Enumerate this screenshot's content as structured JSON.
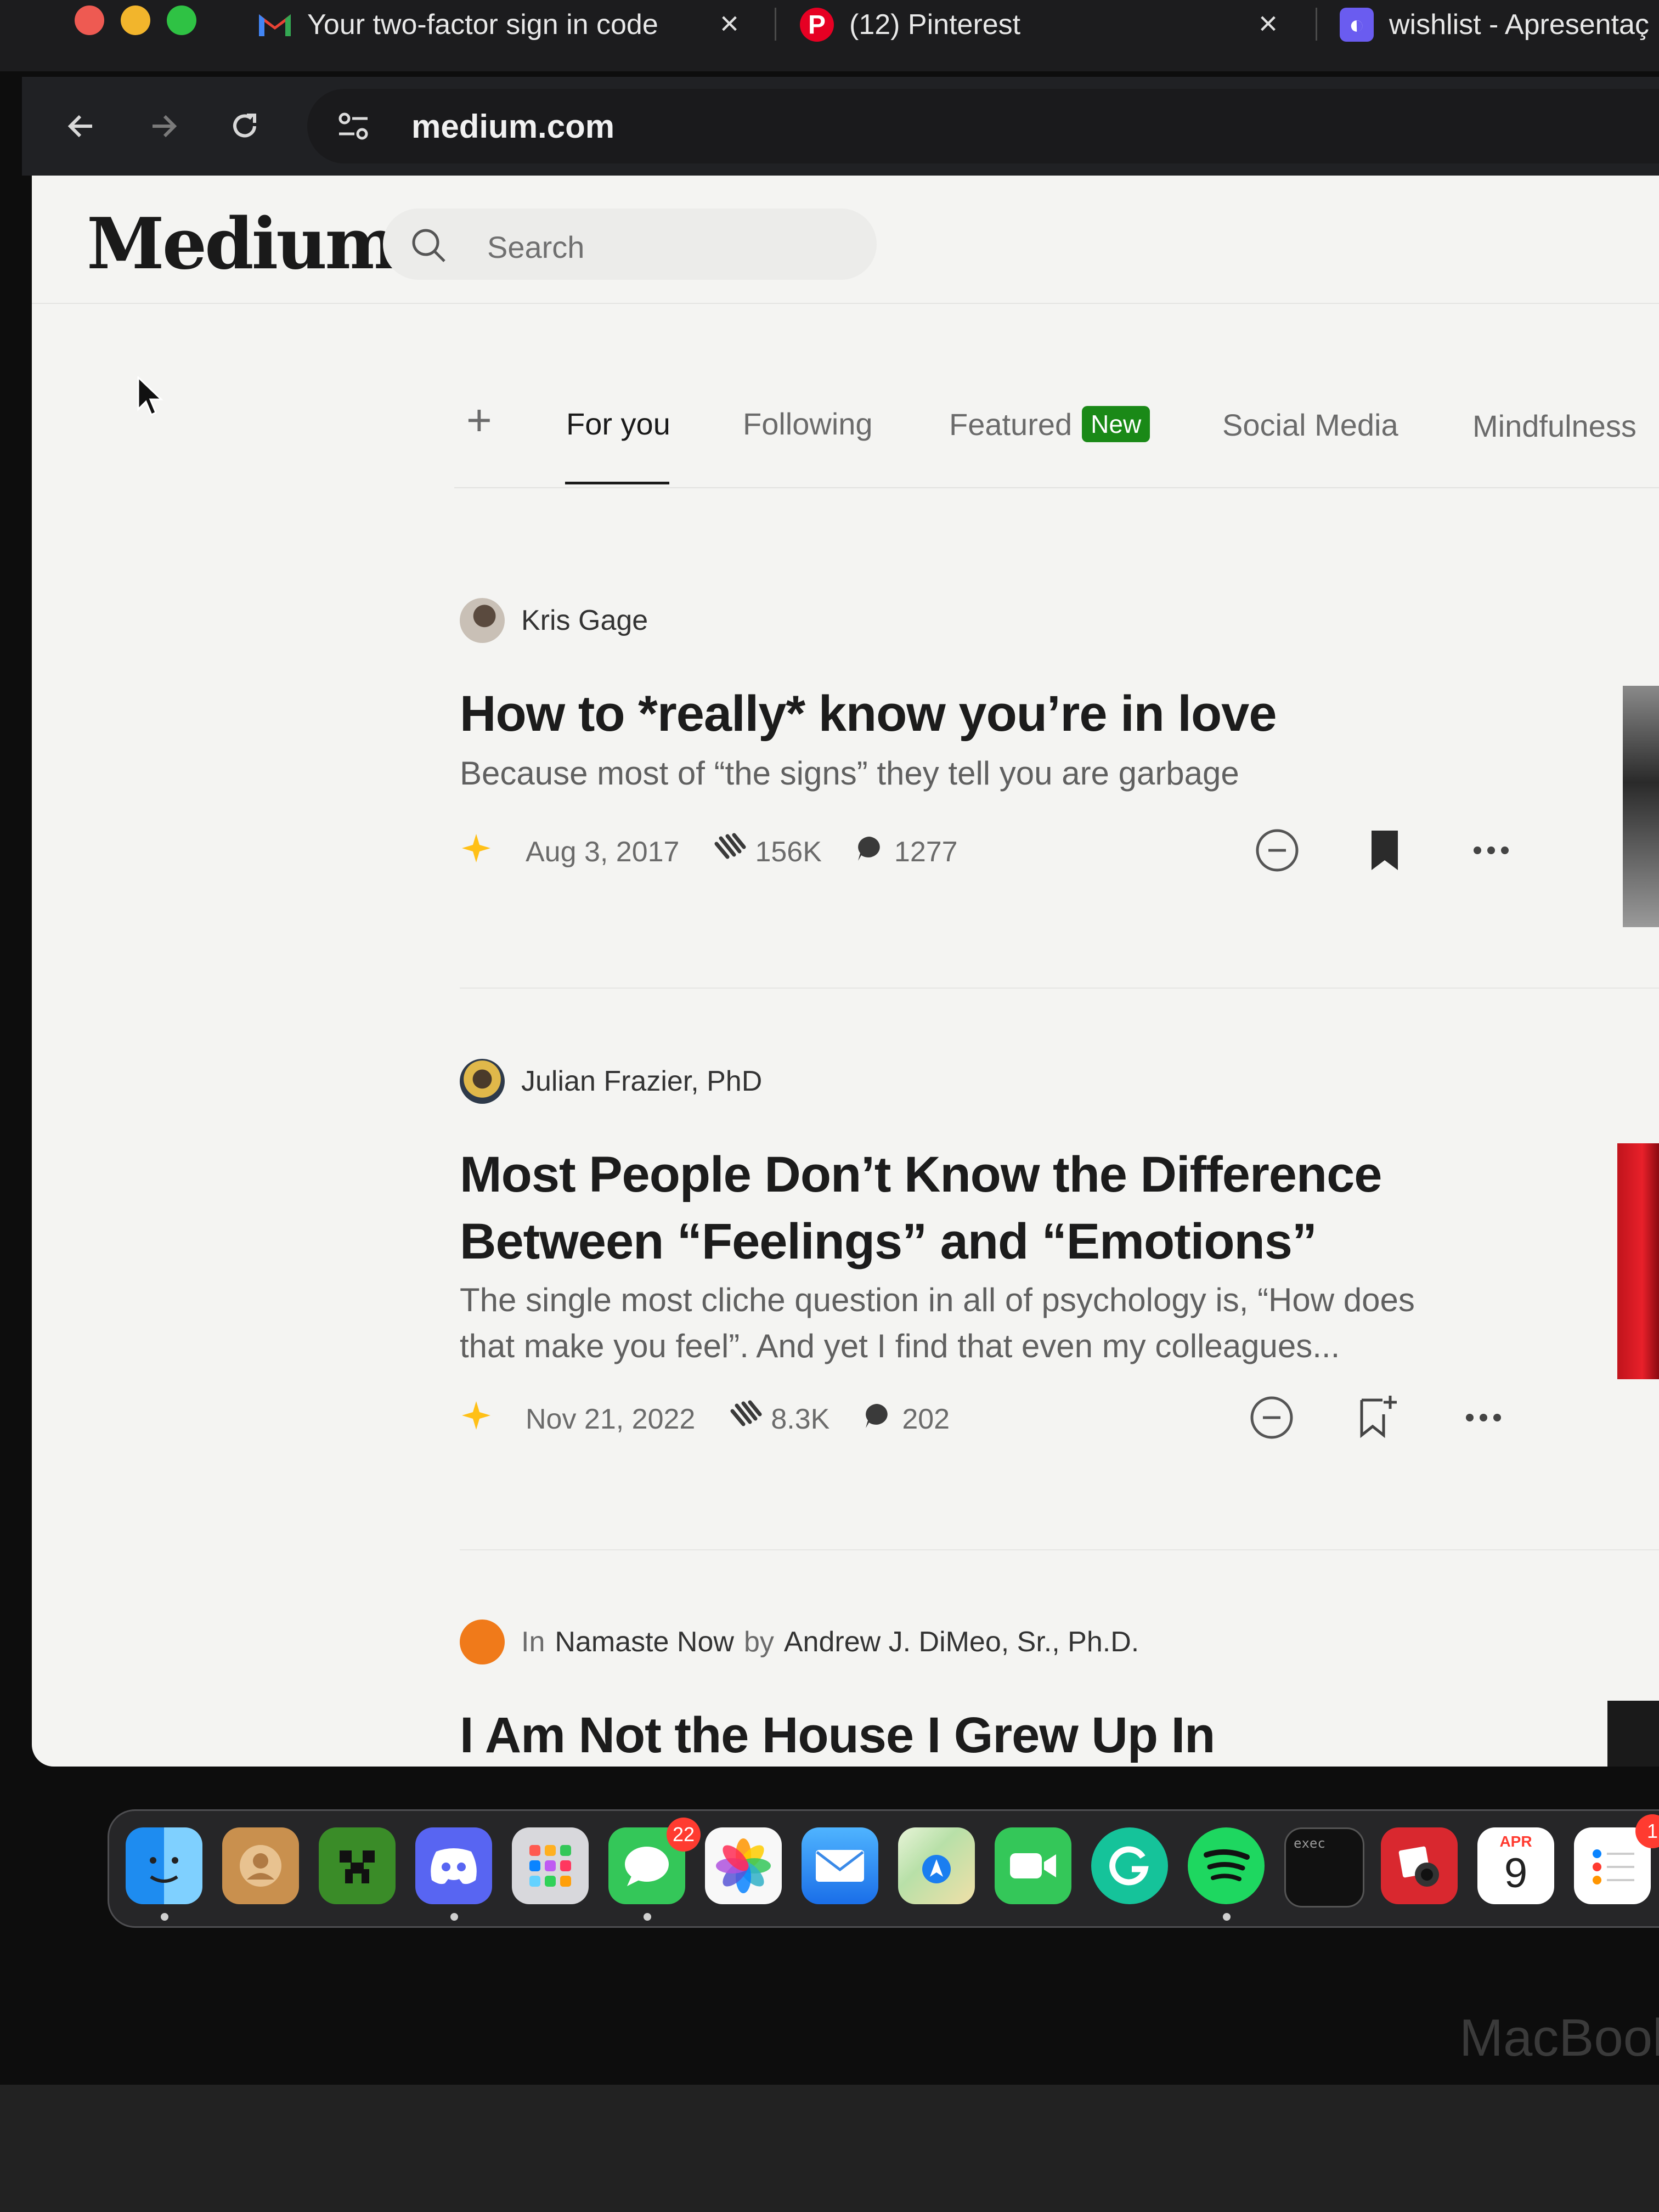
{
  "browser": {
    "tabs": [
      {
        "title": "Your two-factor sign in code",
        "favicon": "gmail-icon"
      },
      {
        "title": "(12) Pinterest",
        "favicon": "pinterest-icon"
      },
      {
        "title": "wishlist - Apresentaç",
        "favicon": "canva-icon"
      }
    ],
    "url": "medium.com"
  },
  "header": {
    "logo": "Medium",
    "search_placeholder": "Search"
  },
  "feed_tabs": {
    "add_label": "+",
    "items": [
      {
        "label": "For you",
        "active": true
      },
      {
        "label": "Following"
      },
      {
        "label": "Featured",
        "badge": "New"
      },
      {
        "label": "Social Media"
      },
      {
        "label": "Mindfulness"
      }
    ]
  },
  "articles": [
    {
      "author": "Kris Gage",
      "title": "How to *really* know you’re in love",
      "subtitle": "Because most of “the signs” they tell you are garbage",
      "date": "Aug 3, 2017",
      "claps": "156K",
      "responses": "1277",
      "saved": true
    },
    {
      "author": "Julian Frazier, PhD",
      "title_line1": "Most People Don’t Know the Difference",
      "title_line2": "Between “Feelings” and “Emotions”",
      "subtitle_line1": "The single most cliche question in all of psychology is, “How does",
      "subtitle_line2": "that make you feel”. And yet I find that even my colleagues...",
      "date": "Nov 21, 2022",
      "claps": "8.3K",
      "responses": "202",
      "saved": false
    },
    {
      "in_label": "In",
      "publication": "Namaste Now",
      "by_label": "by",
      "author": "Andrew J. DiMeo, Sr., Ph.D.",
      "title": "I Am Not the House I Grew Up In"
    }
  ],
  "dock": {
    "messages_badge": "22",
    "calendar_month": "APR",
    "calendar_day": "9",
    "terminal_label": "exec",
    "reminders_badge": "1"
  },
  "laptop_label": "MacBook",
  "colors": {
    "medium_green": "#1a8917",
    "star_gold": "#ffc017",
    "page_bg": "#f4f4f2"
  }
}
